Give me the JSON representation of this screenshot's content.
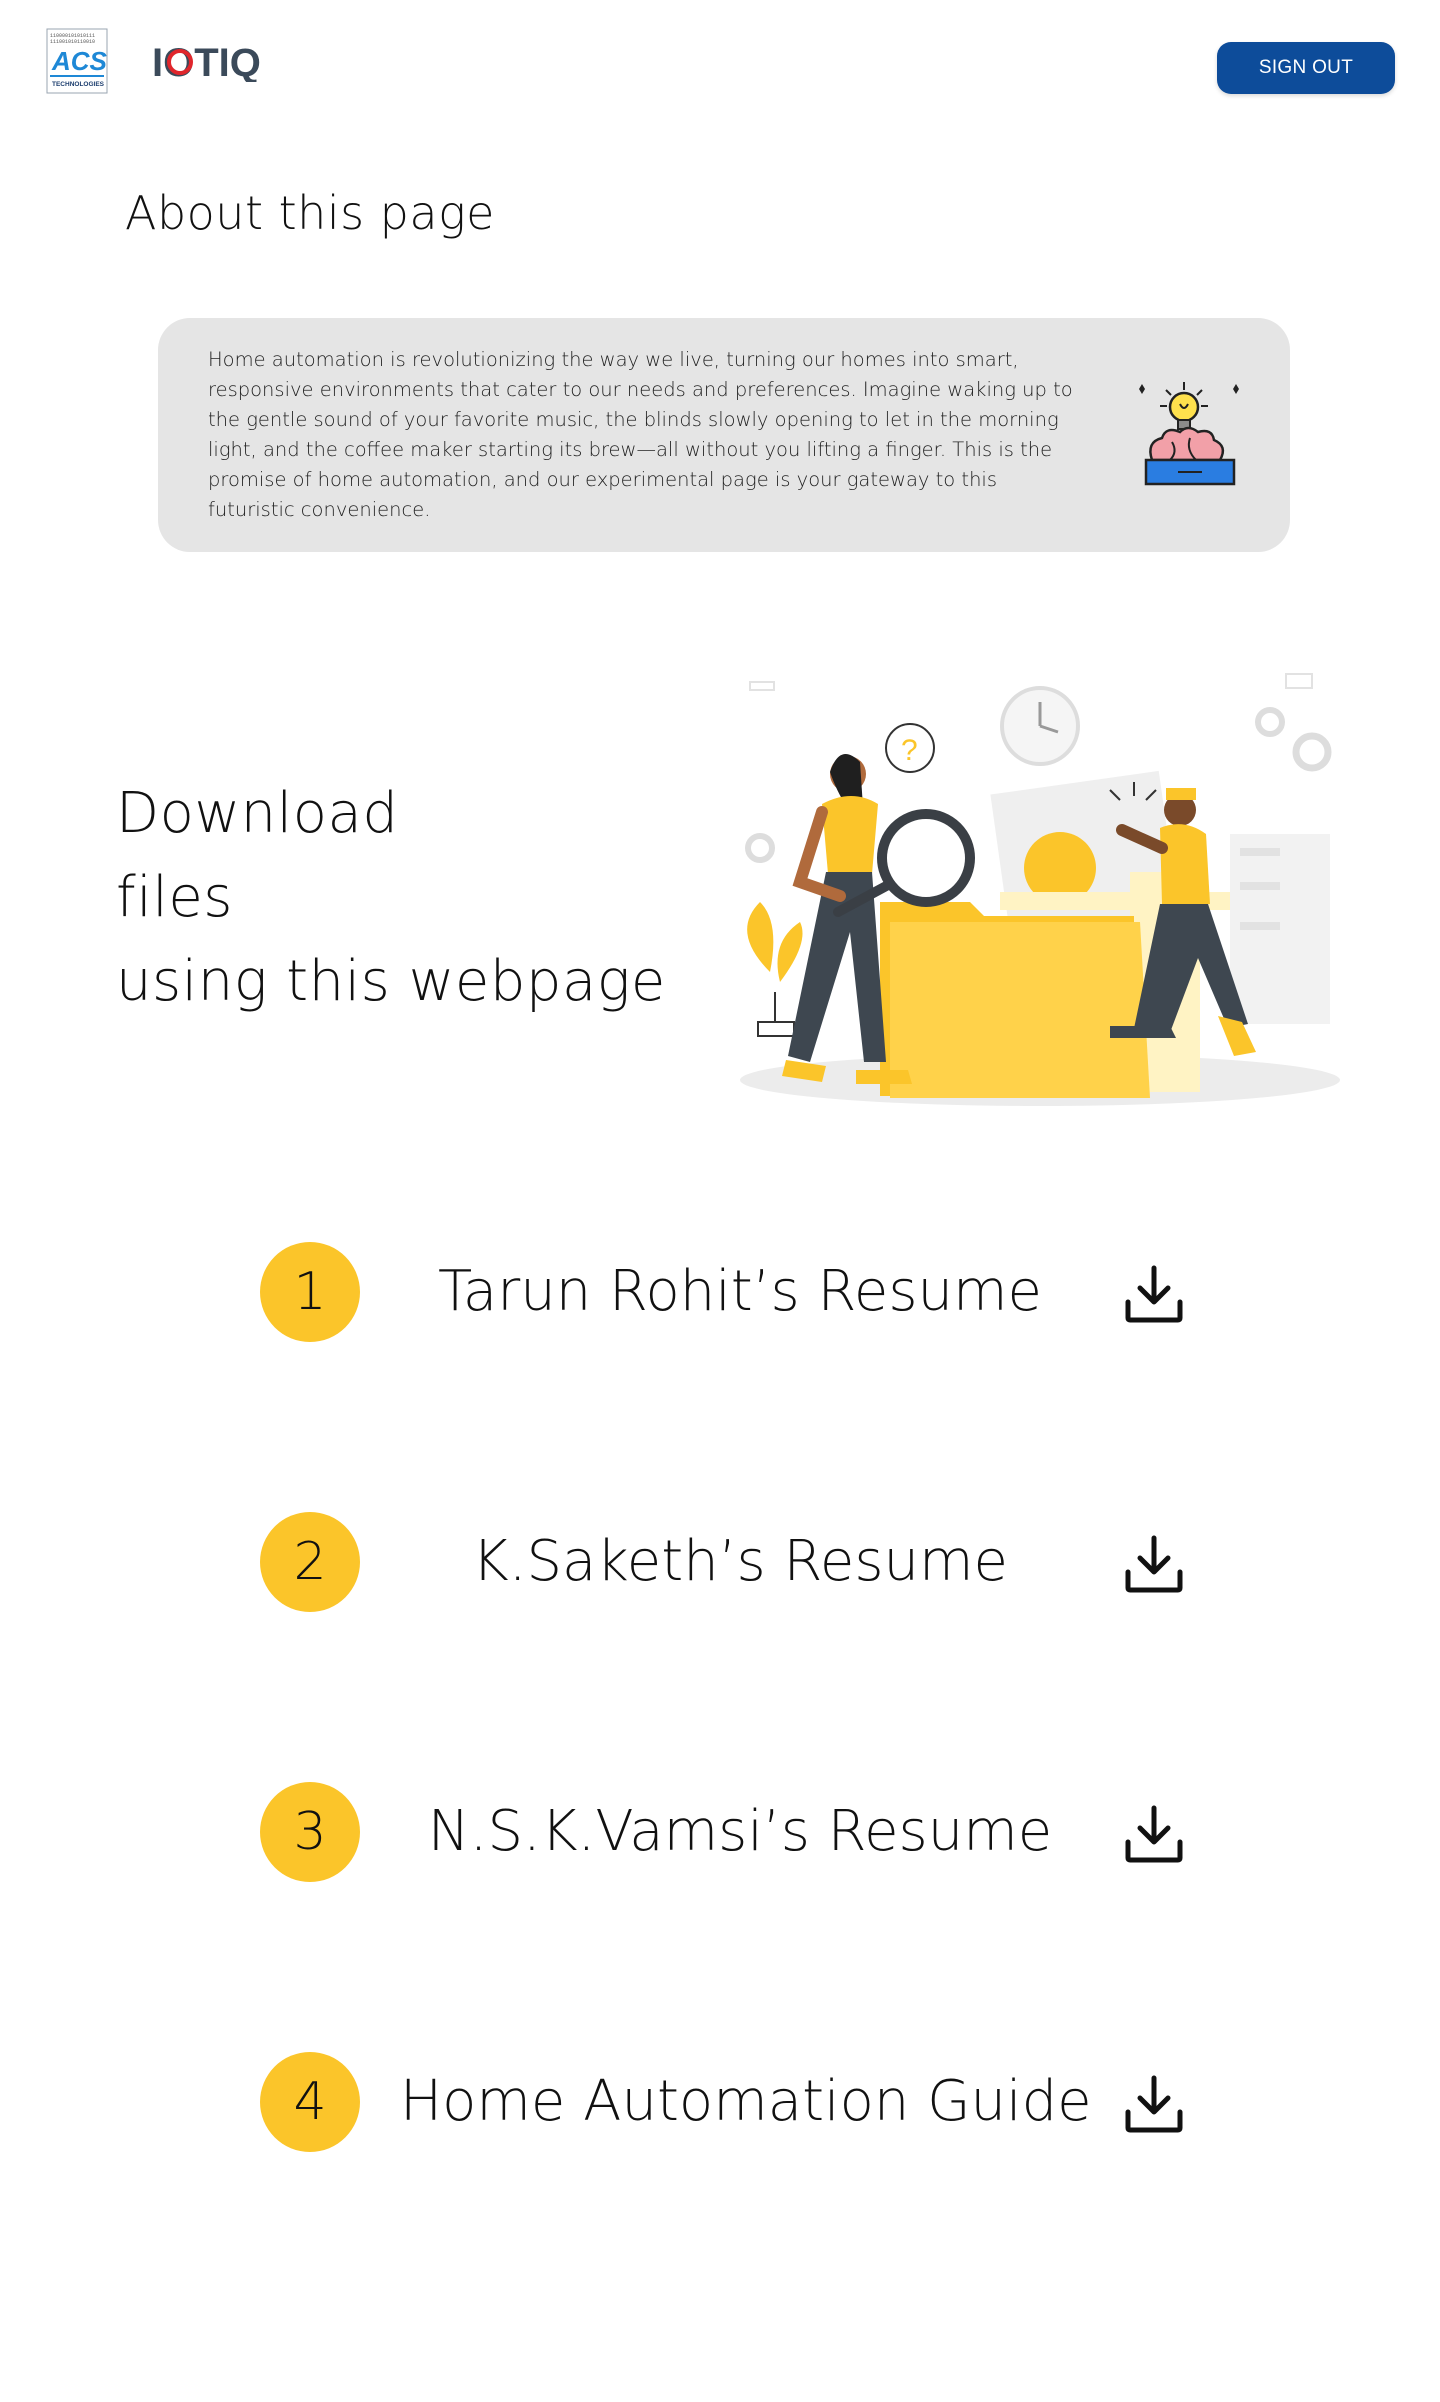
{
  "header": {
    "acs_logo": {
      "name": "ACS",
      "tagline": "TECHNOLOGIES",
      "icon": "acs-logo"
    },
    "iotiq_logo": {
      "text": "IOTIQ",
      "icon": "iotiq-logo"
    },
    "sign_out_label": "SIGN OUT",
    "colors": {
      "button": "#0d4c9a",
      "accent_red": "#e0262c"
    }
  },
  "about": {
    "title": "About this page",
    "body": "Home automation is revolutionizing the way we live, turning our homes into smart, responsive environments that cater to our needs and preferences. Imagine waking up to the gentle sound of your favorite music, the blinds slowly opening to let in the morning light, and the coffee maker starting its brew—all without you lifting a finger. This is the promise of home automation, and our experimental page is your gateway to this futuristic convenience.",
    "icon": "lightbulb-brain-icon"
  },
  "download_section": {
    "title_lines": [
      "Download",
      "files",
      "using this webpage"
    ],
    "illustration": "people-searching-folder-illustration",
    "accent_color": "#fbc52a"
  },
  "files": [
    {
      "number": "1",
      "label": "Tarun Rohit’s Resume",
      "icon": "download-icon"
    },
    {
      "number": "2",
      "label": "K.Saketh’s Resume",
      "icon": "download-icon"
    },
    {
      "number": "3",
      "label": "N.S.K.Vamsi’s Resume",
      "icon": "download-icon"
    },
    {
      "number": "4",
      "label": "Home Automation Guide",
      "icon": "download-icon"
    }
  ]
}
